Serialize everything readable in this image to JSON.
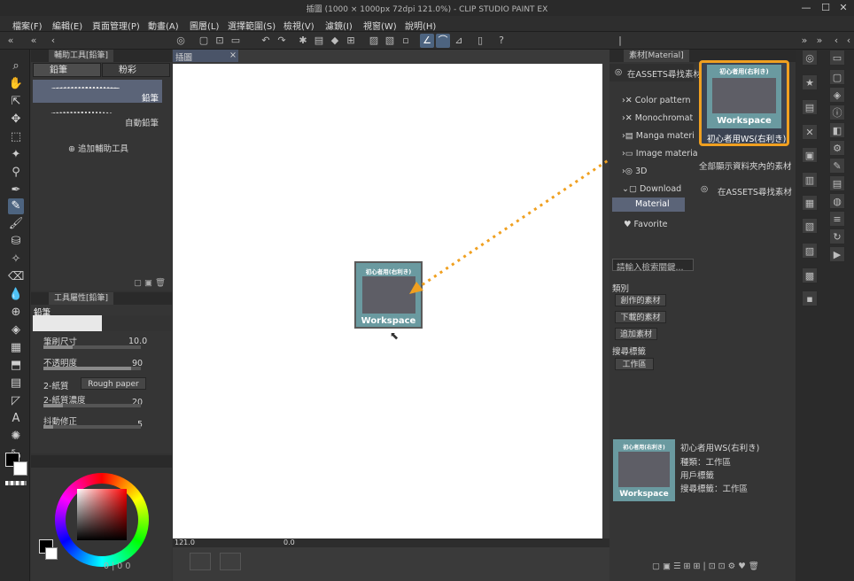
{
  "window": {
    "title": "插圖 (1000 × 1000px 72dpi 121.0%) - CLIP STUDIO PAINT EX",
    "controls": [
      "—",
      "☐",
      "✕"
    ]
  },
  "menu": [
    "檔案(F)",
    "編輯(E)",
    "頁面管理(P)",
    "動畫(A)",
    "圖層(L)",
    "選擇範圍(S)",
    "檢視(V)",
    "濾鏡(I)",
    "視窗(W)",
    "說明(H)"
  ],
  "subtool_panel": {
    "tab": "輔助工具[鉛筆]",
    "subtabs": [
      "鉛筆",
      "粉彩"
    ],
    "brushes": [
      "鉛筆",
      "自動鉛筆"
    ],
    "add_tool": "追加輔助工具"
  },
  "tool_props": {
    "tab": "工具屬性[鉛筆]",
    "title": "鉛筆",
    "props": [
      {
        "label": "筆刷尺寸",
        "value": "10.0"
      },
      {
        "label": "不透明度",
        "value": "90"
      },
      {
        "label": "2-紙質",
        "value": "Rough paper"
      },
      {
        "label": "2-紙質濃度",
        "value": "20"
      },
      {
        "label": "抖動修正",
        "value": "5"
      }
    ]
  },
  "color": {
    "main": "#000000",
    "sub": "#ffffff",
    "wheel_hue": "#ff0000",
    "readout": [
      "0",
      "0",
      "0"
    ]
  },
  "canvas": {
    "tab": "插圖",
    "zoom": "121.0",
    "rotation": "0.0"
  },
  "material_panel": {
    "tab": "素材[Material]",
    "search_assets": "在ASSETS尋找素材",
    "folders": [
      "Color pattern",
      "Monochromat",
      "Manga materi",
      "Image materia",
      "3D",
      "Download",
      "Material",
      "Favorite"
    ],
    "search_placeholder": "請輸入檢索關鍵...",
    "tags_label": "類別",
    "tag_buttons": [
      "創作的素材",
      "下載的素材",
      "追加素材"
    ],
    "search_tags_label": "搜尋標籤",
    "search_tag": "工作區",
    "selected_thumb": {
      "top_label": "初心者用(右利き)",
      "main_label": "Workspace",
      "caption": "初心者用WS(右利き)"
    },
    "right_list": [
      "全部顯示資料夾內的素材",
      "在ASSETS尋找素材"
    ],
    "detail": {
      "name": "初心者用WS(右利き)",
      "type": "種類：工作區",
      "user_tag": "用戶標籤",
      "search_tag": "搜尋標籤：工作區"
    }
  },
  "drag_thumb": {
    "top_label": "初心者用(右利き)",
    "main_label": "Workspace"
  },
  "colors": {
    "accent": "#f0a020",
    "select_blue": "#4d6480",
    "thumb_teal": "#6a9aa0"
  }
}
